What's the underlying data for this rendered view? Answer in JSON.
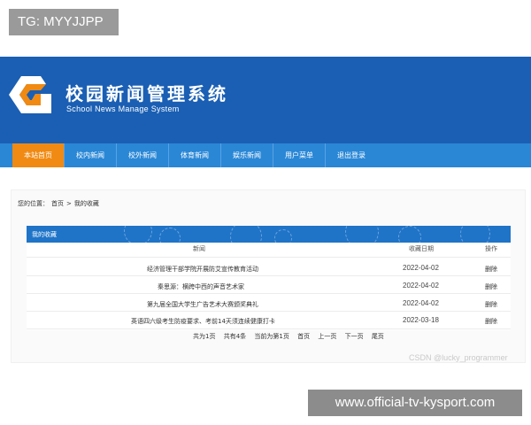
{
  "tg_badge": "TG: MYYJJPP",
  "site": {
    "title": "校园新闻管理系统",
    "subtitle": "School News Manage System"
  },
  "nav": {
    "items": [
      {
        "label": "本站首页"
      },
      {
        "label": "校内新闻"
      },
      {
        "label": "校外新闻"
      },
      {
        "label": "体育新闻"
      },
      {
        "label": "娱乐新闻"
      },
      {
        "label": "用户菜单"
      },
      {
        "label": "退出登录"
      }
    ]
  },
  "breadcrumb": {
    "prefix": "您的位置：",
    "home": "首页",
    "sep": ">",
    "current": "我的收藏"
  },
  "panel": {
    "title": "我的收藏",
    "columns": {
      "news": "新闻",
      "date": "收藏日期",
      "op": "操作"
    },
    "rows": [
      {
        "news": "经济管理干部学院开展防艾宣传教育活动",
        "date": "2022-04-02",
        "op": "删除"
      },
      {
        "news": "秦思源：横跨中西的声音艺术家",
        "date": "2022-04-02",
        "op": "删除"
      },
      {
        "news": "第九届全国大学生广告艺术大赛颁奖典礼",
        "date": "2022-04-02",
        "op": "删除"
      },
      {
        "news": "英语四六级考生防疫要求、考前14天须连续健康打卡",
        "date": "2022-03-18",
        "op": "删除"
      }
    ]
  },
  "pager": {
    "total_pages": "共为1页",
    "total_items": "共有4条",
    "current": "当前为第1页",
    "first": "首页",
    "prev": "上一页",
    "next": "下一页",
    "last": "尾页"
  },
  "watermark": "CSDN @lucky_programmer",
  "bottom_badge": "www.official-tv-kysport.com",
  "colors": {
    "header": "#1a5fb4",
    "nav": "#2a87d6",
    "nav_active": "#f08a12",
    "panel_header": "#1f74c8"
  }
}
